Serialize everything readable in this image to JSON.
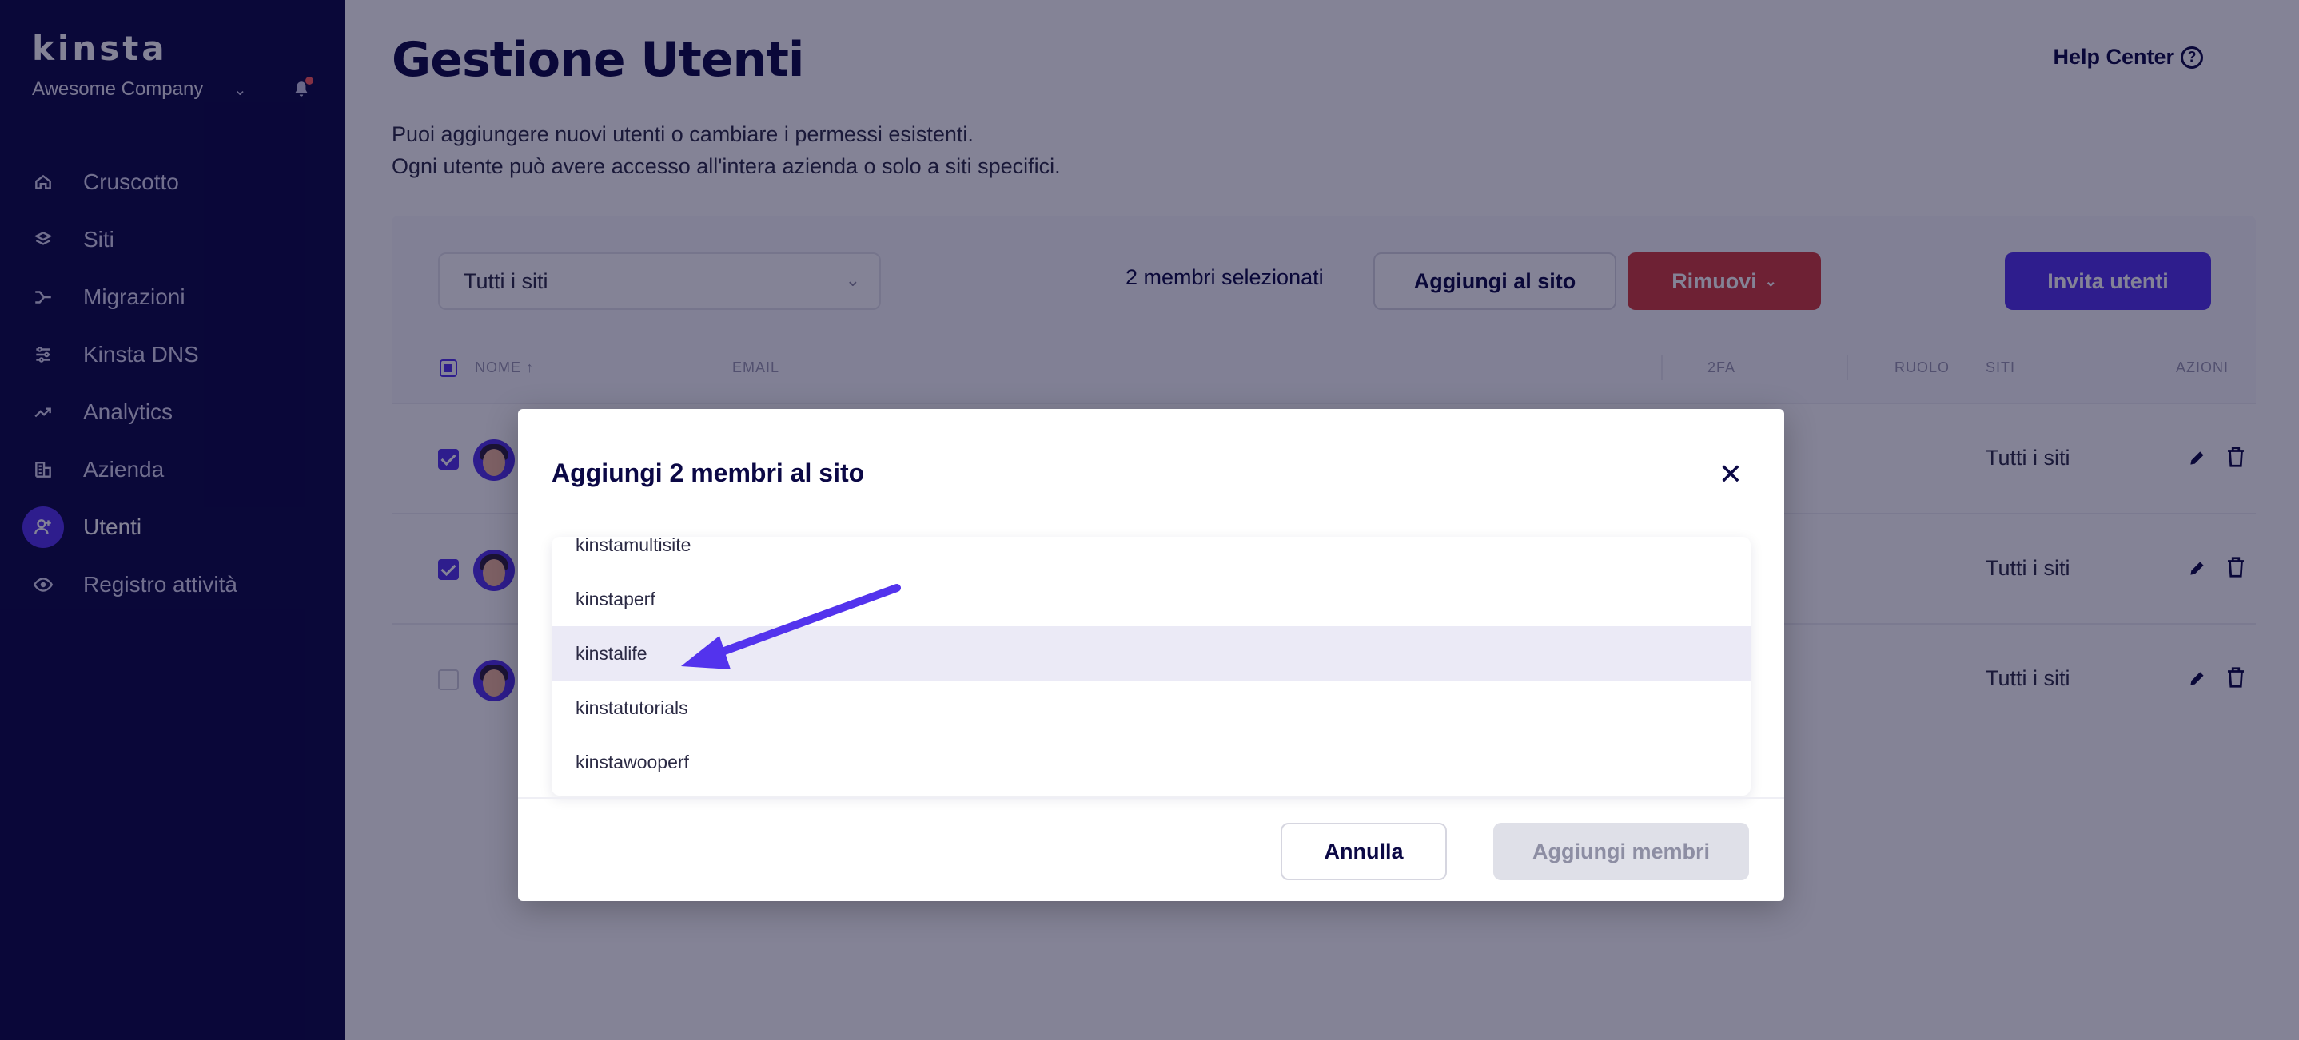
{
  "sidebar": {
    "logo": "kinsta",
    "company": "Awesome Company",
    "items": [
      {
        "label": "Cruscotto",
        "icon": "home-icon"
      },
      {
        "label": "Siti",
        "icon": "layers-icon"
      },
      {
        "label": "Migrazioni",
        "icon": "migration-icon"
      },
      {
        "label": "Kinsta DNS",
        "icon": "dns-icon"
      },
      {
        "label": "Analytics",
        "icon": "trend-icon"
      },
      {
        "label": "Azienda",
        "icon": "building-icon"
      },
      {
        "label": "Utenti",
        "icon": "user-add-icon",
        "active": true
      },
      {
        "label": "Registro attività",
        "icon": "eye-icon"
      }
    ]
  },
  "header": {
    "title": "Gestione Utenti",
    "help": "Help Center",
    "description_line1": "Puoi aggiungere nuovi utenti o cambiare i permessi esistenti.",
    "description_line2": "Ogni utente può avere accesso all'intera azienda o solo a siti specifici."
  },
  "toolbar": {
    "site_filter": "Tutti i siti",
    "selected_count": "2 membri selezionati",
    "add_to_site": "Aggiungi al sito",
    "remove": "Rimuovi",
    "invite": "Invita utenti"
  },
  "table": {
    "headers": {
      "name": "NOME ↑",
      "email": "EMAIL",
      "twofa": "2FA",
      "role": "RUOLO",
      "sites": "SITI",
      "actions": "AZIONI"
    },
    "rows": [
      {
        "sites": "Tutti i siti",
        "checked": true
      },
      {
        "sites": "Tutti i siti",
        "checked": true
      },
      {
        "sites": "Tutti i siti",
        "checked": false
      }
    ]
  },
  "modal": {
    "title": "Aggiungi 2 membri al sito",
    "options": [
      "kinstamultisite",
      "kinstaperf",
      "kinstalife",
      "kinstatutorials",
      "kinstawooperf"
    ],
    "highlighted_option": "kinstalife",
    "cancel": "Annulla",
    "submit": "Aggiungi membri"
  },
  "colors": {
    "sidebar_bg": "#0b0845",
    "accent": "#5333ed",
    "danger": "#d23b3b",
    "annotation_arrow": "#5333ed"
  }
}
